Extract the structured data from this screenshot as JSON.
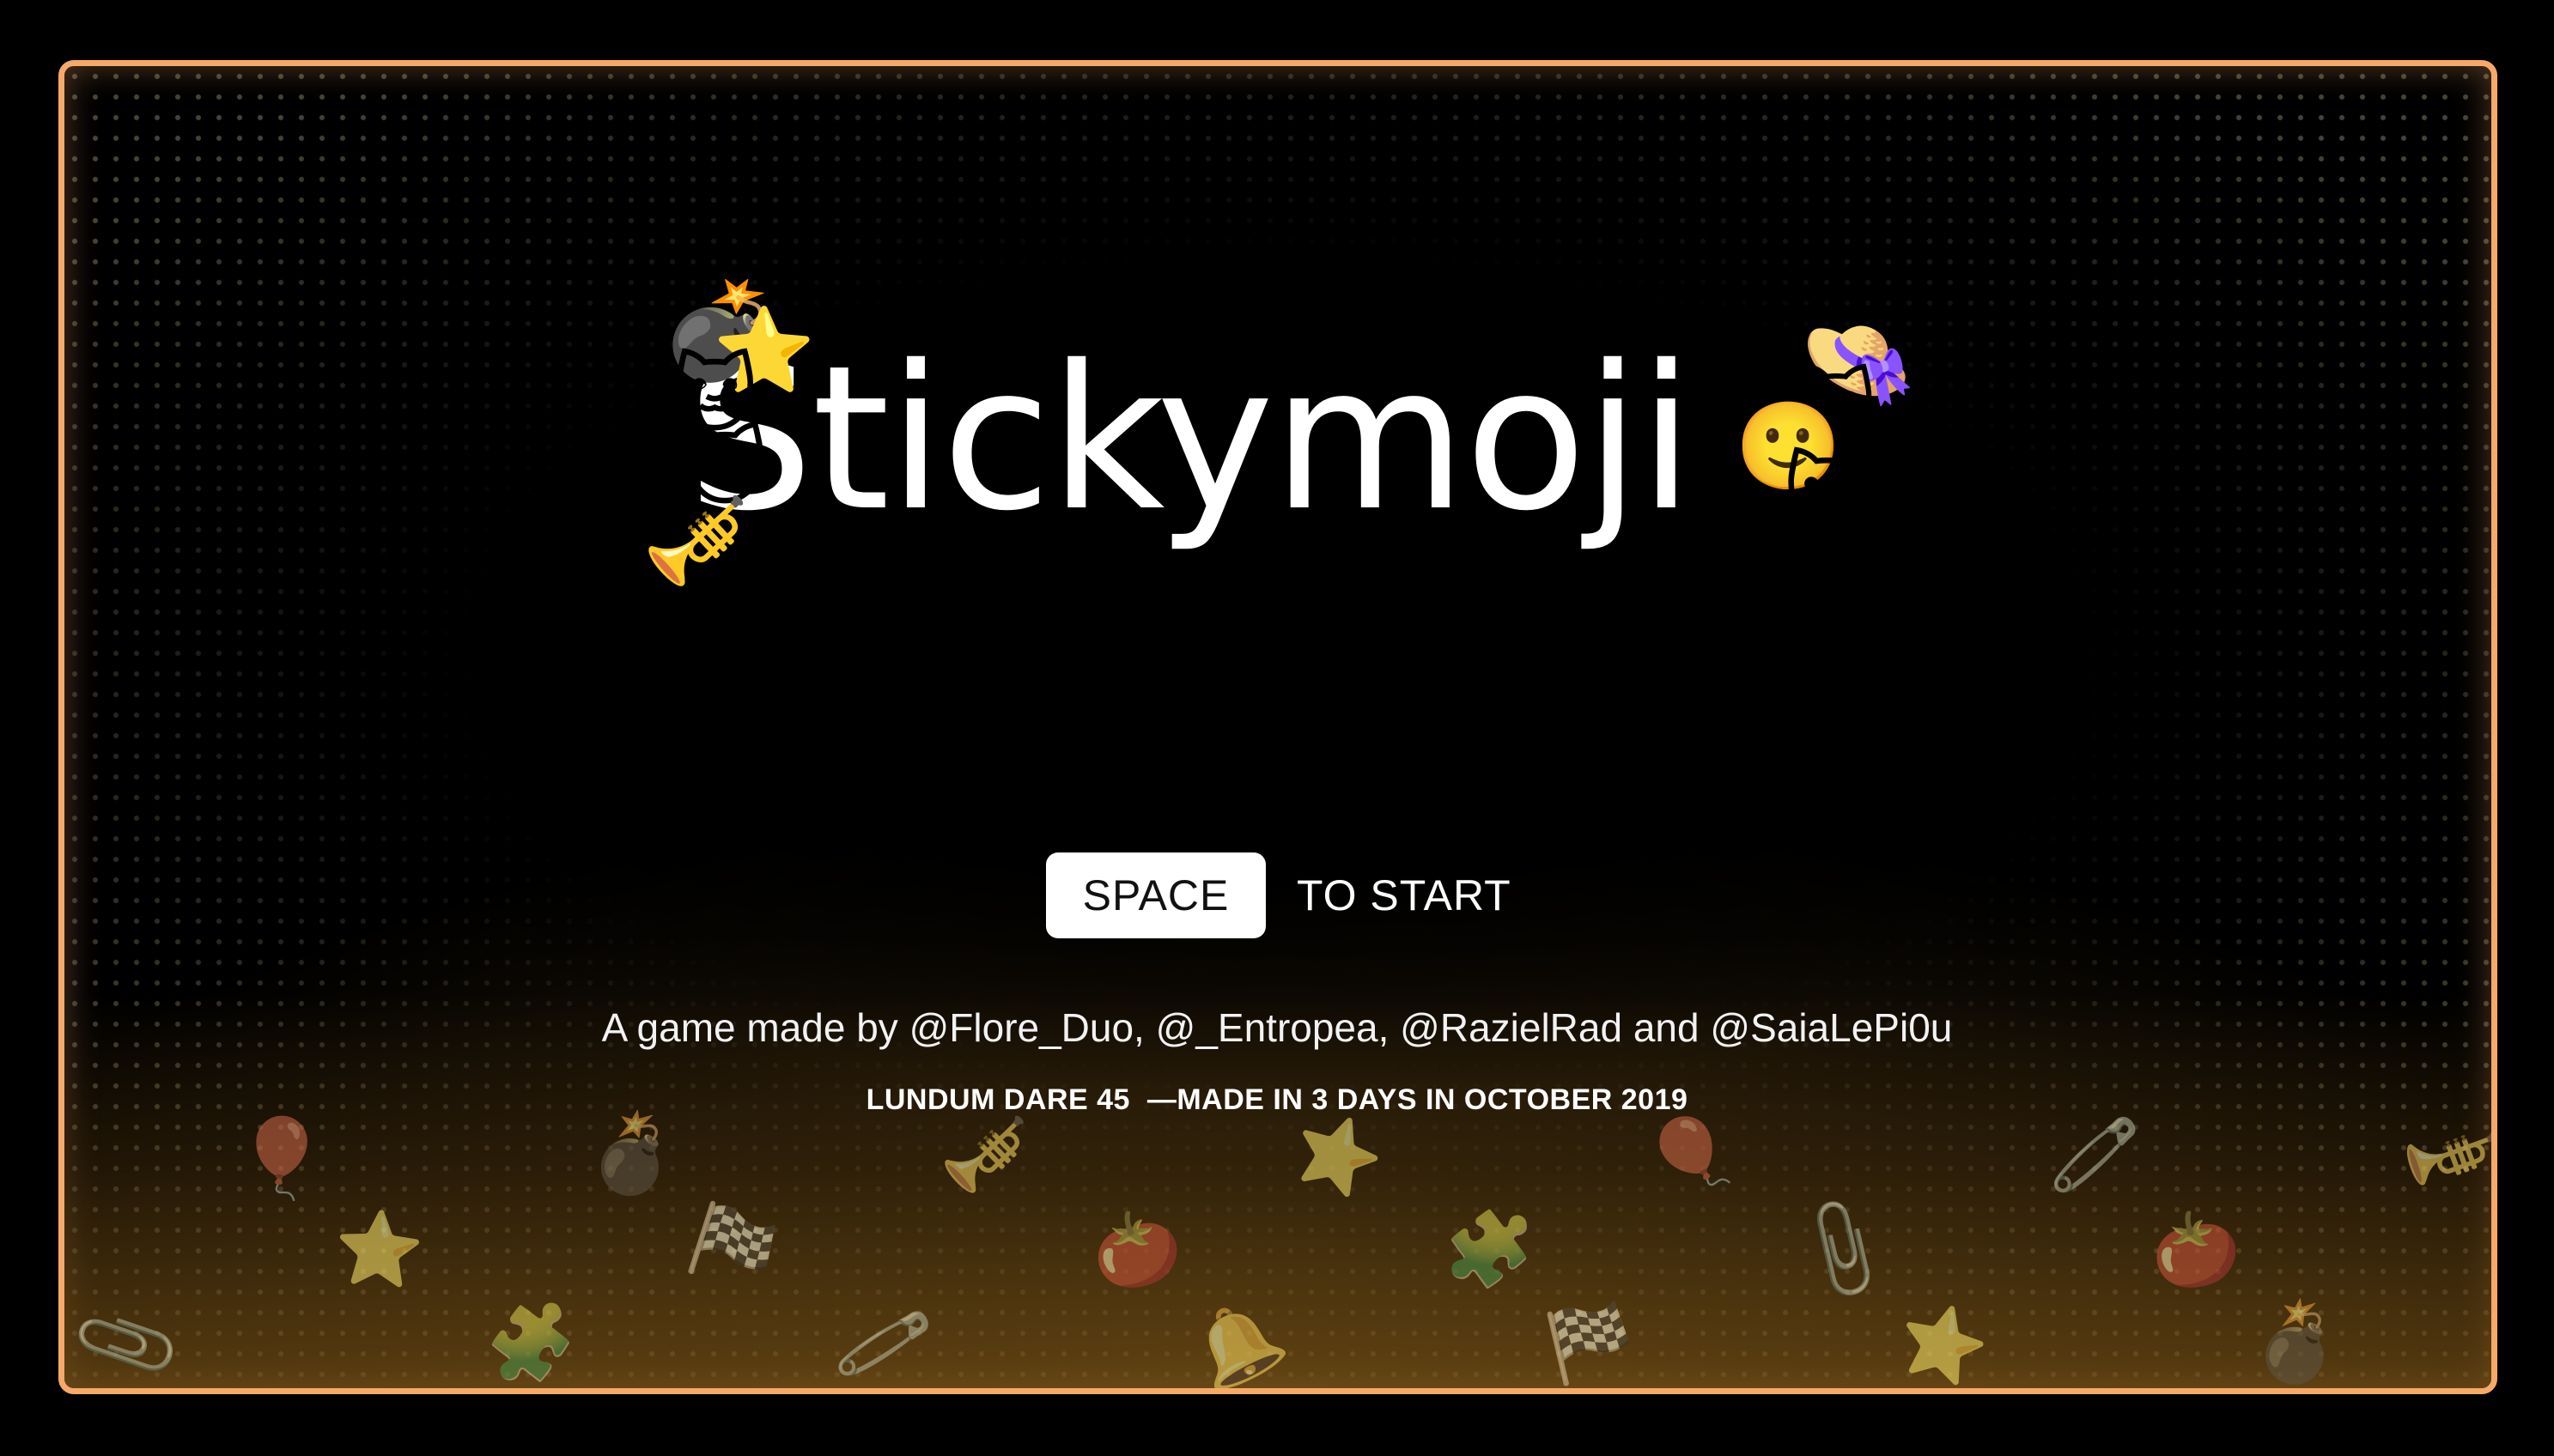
{
  "game": {
    "title": "Stickymoji",
    "start_key": "SPACE",
    "start_label": "TO START",
    "credits": "A game made by @Flore_Duo, @_Entropea, @RazielRad and @SaiaLePi0u",
    "event_line": "LUNDUM DARE 45  —MADE IN 3 DAYS IN OCTOBER 2019"
  },
  "logo_emojis": [
    {
      "name": "bomb-emoji",
      "glyph": "💣"
    },
    {
      "name": "star-emoji",
      "glyph": "⭐"
    },
    {
      "name": "cat-emoji-1",
      "glyph": "🐱"
    },
    {
      "name": "cat-emoji-2",
      "glyph": "🐱"
    },
    {
      "name": "trumpet-emoji",
      "glyph": "🎺"
    },
    {
      "name": "cat-emoji-3",
      "glyph": "🐱"
    },
    {
      "name": "cat-emoji-4",
      "glyph": "🐱"
    },
    {
      "name": "cat-emoji-5",
      "glyph": "🐱"
    },
    {
      "name": "cat-emoji-6",
      "glyph": "🐱"
    },
    {
      "name": "hat-emoji",
      "glyph": "👒"
    },
    {
      "name": "cat-emoji-7",
      "glyph": "🐱"
    },
    {
      "name": "smiley-emoji",
      "glyph": "🙂"
    },
    {
      "name": "cat-emoji-8",
      "glyph": "🐱"
    }
  ],
  "pile_emojis": [
    "📎",
    "🎈",
    "⭐",
    "🧩",
    "💣",
    "🏁",
    "🧷",
    "🎺",
    "🍅",
    "🔔",
    "⭐",
    "🧩",
    "🏁",
    "🎈",
    "📎",
    "⭐",
    "🧷",
    "🍅",
    "💣",
    "🎺"
  ],
  "colors": {
    "frame_border": "#f6a968",
    "background": "#000000",
    "text": "#ffffff",
    "key_background": "#ffffff"
  }
}
